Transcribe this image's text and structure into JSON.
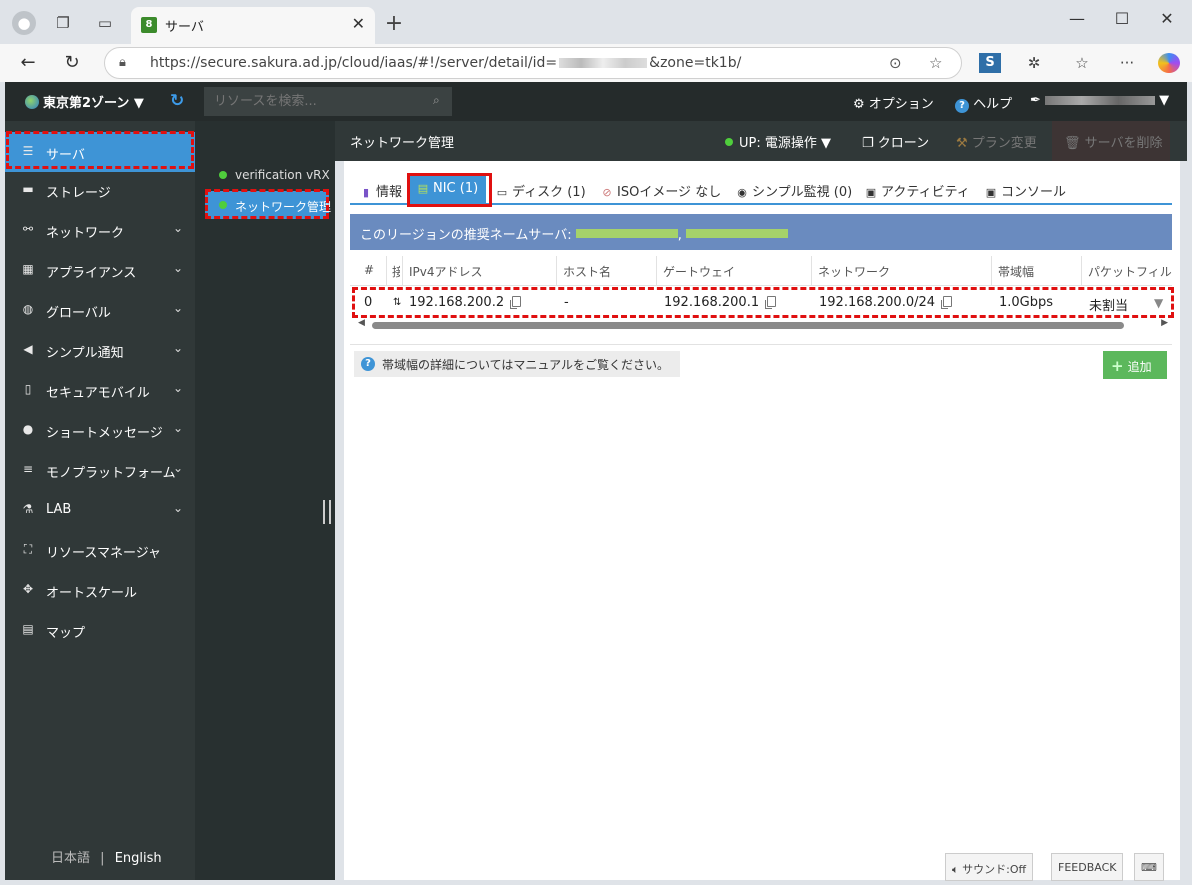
{
  "browser": {
    "tab_title": "サーバ",
    "tab_favicon_text": "8",
    "url_prefix": "https://secure.sakura.ad.jp/cloud/iaas/#!/server/detail/id=",
    "url_suffix": "&zone=tk1b/",
    "new_tab": "+",
    "close": "✕"
  },
  "header": {
    "zone_label": "東京第2ゾーン ▼",
    "search_placeholder": "リソースを検索...",
    "options_label": "オプション",
    "help_label": "ヘルプ",
    "user_arrow": "▼"
  },
  "sidebar": {
    "items": [
      {
        "label": "サーバ",
        "icon": "server-icon",
        "glyph": "☰",
        "chevron": ""
      },
      {
        "label": "ストレージ",
        "icon": "storage-icon",
        "glyph": "▬",
        "chevron": ""
      },
      {
        "label": "ネットワーク",
        "icon": "network-icon",
        "glyph": "⚯",
        "chevron": "⌄"
      },
      {
        "label": "アプライアンス",
        "icon": "appliance-icon",
        "glyph": "▦",
        "chevron": "⌄"
      },
      {
        "label": "グローバル",
        "icon": "globe-icon",
        "glyph": "◍",
        "chevron": "⌄"
      },
      {
        "label": "シンプル通知",
        "icon": "megaphone-icon",
        "glyph": "◀",
        "chevron": "⌄"
      },
      {
        "label": "セキュアモバイル",
        "icon": "mobile-icon",
        "glyph": "▯",
        "chevron": "⌄"
      },
      {
        "label": "ショートメッセージ",
        "icon": "message-icon",
        "glyph": "●",
        "chevron": "⌄"
      },
      {
        "label": "モノプラットフォーム",
        "icon": "platform-icon",
        "glyph": "≡",
        "chevron": "⌄"
      },
      {
        "label": "LAB",
        "icon": "flask-icon",
        "glyph": "⚗",
        "chevron": "⌄"
      },
      {
        "label": "リソースマネージャ",
        "icon": "resource-manager-icon",
        "glyph": "⛶",
        "chevron": ""
      },
      {
        "label": "オートスケール",
        "icon": "autoscale-icon",
        "glyph": "✥",
        "chevron": ""
      },
      {
        "label": "マップ",
        "icon": "map-icon",
        "glyph": "▤",
        "chevron": ""
      }
    ],
    "lang_ja": "日本語",
    "lang_sep": "|",
    "lang_en": "English"
  },
  "subnav": {
    "items": [
      {
        "label": "verification vRX"
      },
      {
        "label": "ネットワーク管理"
      }
    ]
  },
  "content_header": {
    "title": "ネットワーク管理",
    "power_label": "UP: 電源操作 ▼",
    "clone_label": "クローン",
    "plan_label": "プラン変更",
    "delete_label": "サーバを削除"
  },
  "tabs": [
    {
      "label": "情報",
      "icon": "database-icon"
    },
    {
      "label": "NIC (1)",
      "icon": "nic-icon"
    },
    {
      "label": "ディスク (1)",
      "icon": "disk-icon"
    },
    {
      "label": "ISOイメージ なし",
      "icon": "cd-icon"
    },
    {
      "label": "シンプル監視 (0)",
      "icon": "monitor-eye-icon"
    },
    {
      "label": "アクティビティ",
      "icon": "activity-icon"
    },
    {
      "label": "コンソール",
      "icon": "console-icon"
    }
  ],
  "banner": {
    "text": "このリージョンの推奨ネームサーバ:",
    "sep": ","
  },
  "table": {
    "headers": [
      "#",
      "接",
      "IPv4アドレス",
      "ホスト名",
      "ゲートウェイ",
      "ネットワーク",
      "帯域幅",
      "パケットフィルタ"
    ],
    "rows": [
      {
        "index": "0",
        "ipv4": "192.168.200.2",
        "hostname": "-",
        "gateway": "192.168.200.1",
        "network": "192.168.200.0/24",
        "bandwidth": "1.0Gbps",
        "packet_filter": "未割当"
      }
    ]
  },
  "help_note": "帯域幅の詳細についてはマニュアルをご覧ください。",
  "add_button": "追加",
  "footer": {
    "sound": "サウンド:Off",
    "feedback": "FEEDBACK"
  }
}
